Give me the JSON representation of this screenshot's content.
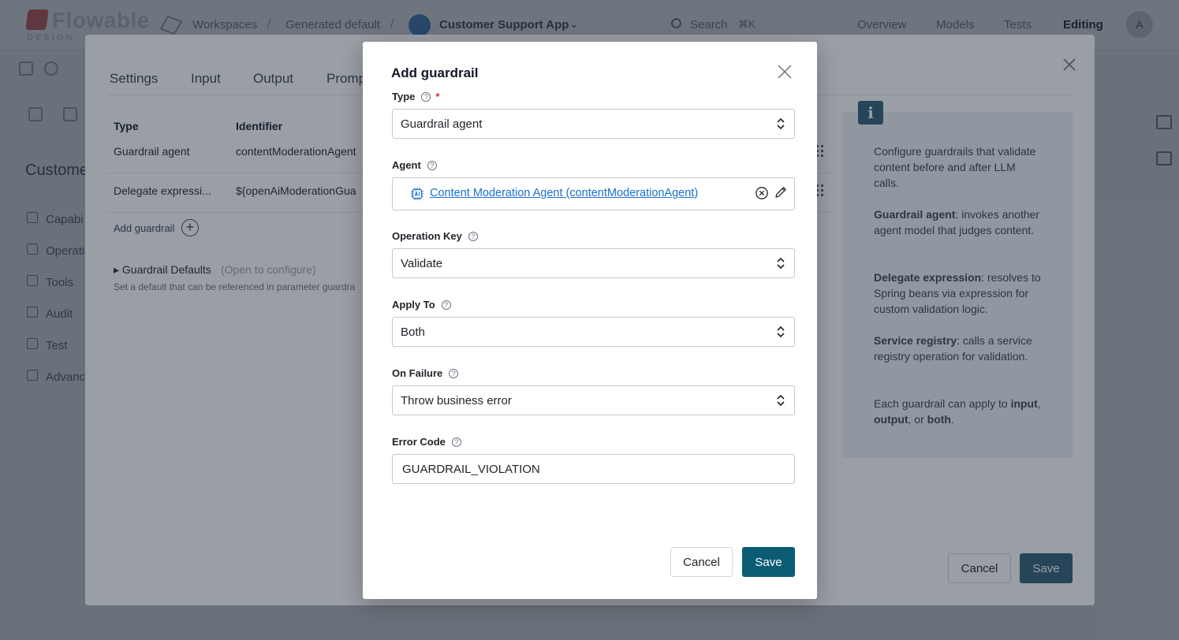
{
  "app": {
    "logo_text": "Flowable",
    "logo_sub": "DESIGN",
    "breadcrumb": [
      "Workspaces",
      "Generated default",
      "Customer Support App"
    ],
    "search_placeholder": "Search",
    "search_shortcut": "⌘K",
    "nav": [
      "Overview",
      "Models",
      "Tests",
      "Editing"
    ],
    "user_initial": "A"
  },
  "sidebar": {
    "title": "Custome",
    "items": [
      "Capabi",
      "Operatio",
      "Tools",
      "Audit",
      "Test",
      "Advanc"
    ]
  },
  "editor": {
    "tabs": [
      "Settings",
      "Input",
      "Output",
      "Promp"
    ],
    "columns": [
      "Type",
      "Identifier"
    ],
    "rows": [
      {
        "type": "Guardrail agent",
        "identifier": "contentModerationAgent"
      },
      {
        "type": "Delegate expressi...",
        "identifier": "${openAiModerationGua"
      }
    ],
    "add_guardrail": "Add guardrail",
    "defaults_title": "▸ Guardrail Defaults",
    "defaults_hint": "(Open to configure)",
    "defaults_sub": "Set a default that can be referenced in parameter guardra",
    "cancel_label": "Cancel",
    "save_label": "Save",
    "info": {
      "p1": "Configure guardrails that validate content before and after LLM calls.",
      "p2_bold": "Guardrail agent",
      "p2_rest": ": invokes another agent model that judges content.",
      "p3_bold": "Delegate expression",
      "p3_rest": ": resolves to Spring beans via expression for custom validation logic.",
      "p4_bold": "Service registry",
      "p4_rest": ": calls a service registry operation for validation.",
      "p5_a": "Each guardrail can apply to ",
      "p5_input": "input",
      "p5_comma": ", ",
      "p5_output": "output",
      "p5_or": ", or ",
      "p5_both": "both",
      "p5_end": "."
    }
  },
  "modal": {
    "title": "Add guardrail",
    "type_label": "Type",
    "type_value": "Guardrail agent",
    "agent_label": "Agent",
    "agent_value": "Content Moderation Agent (contentModerationAgent)",
    "operation_label": "Operation Key",
    "operation_value": "Validate",
    "apply_label": "Apply To",
    "apply_value": "Both",
    "failure_label": "On Failure",
    "failure_value": "Throw business error",
    "error_label": "Error Code",
    "error_value": "GUARDRAIL_VIOLATION",
    "cancel_label": "Cancel",
    "save_label": "Save",
    "help_glyph": "?",
    "required_glyph": "*"
  },
  "colors": {
    "primary": "#0b5c73",
    "link": "#1a6fc9",
    "required": "#dc2626",
    "info_badge": "#2c5d75"
  }
}
